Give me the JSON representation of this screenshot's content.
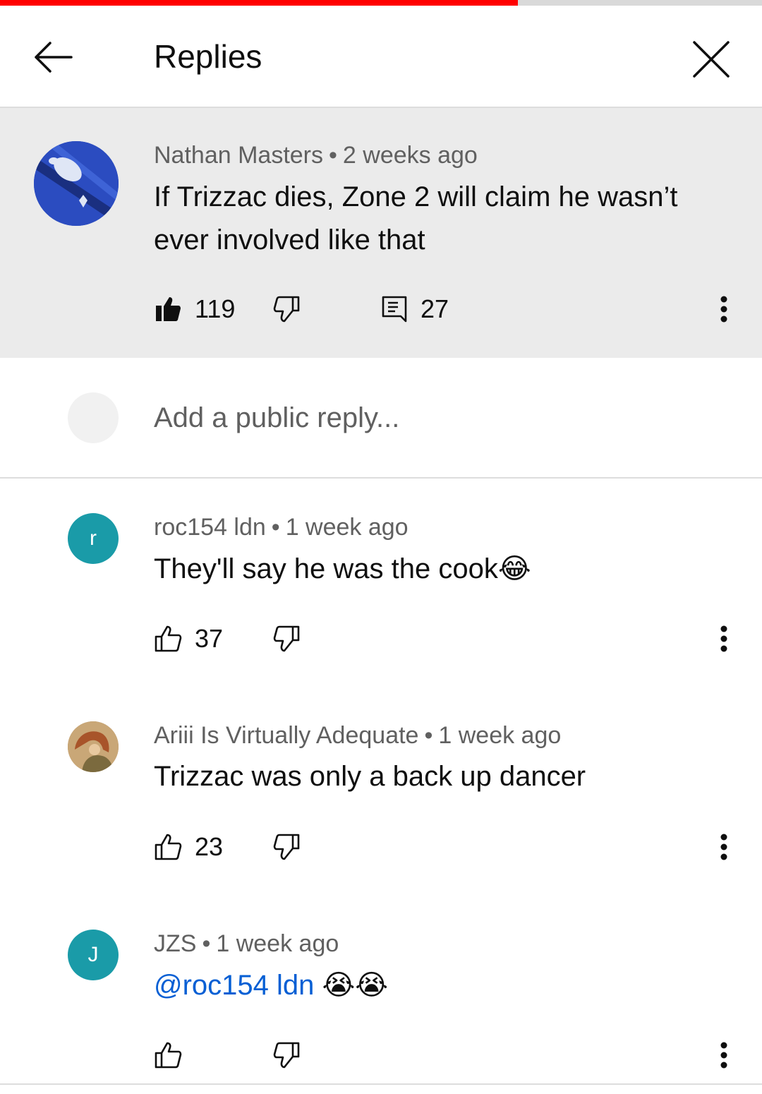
{
  "progress": {
    "fraction": 0.68,
    "color": "#ff0000"
  },
  "header": {
    "title": "Replies",
    "back_icon": "arrow-left-icon",
    "close_icon": "close-icon"
  },
  "parent_comment": {
    "author": "Nathan Masters",
    "time": "2 weeks ago",
    "text": "If Trizzac dies, Zone 2 will claim he wasn’t ever involved like that",
    "likes": "119",
    "replies": "27",
    "liked": true
  },
  "composer": {
    "placeholder": "Add a public reply..."
  },
  "replies": [
    {
      "avatar_letter": "r",
      "avatar_color": "#1a9ba8",
      "author": "roc154 ldn",
      "time": "1 week ago",
      "text": "They'll say he was the cook",
      "emoji": "😂",
      "likes": "37"
    },
    {
      "avatar_color": "#b08a5a",
      "author": "Ariii Is Virtually Adequate",
      "time": "1 week ago",
      "text": "Trizzac was only a back up dancer",
      "likes": "23"
    },
    {
      "avatar_letter": "J",
      "avatar_color": "#1a9ba8",
      "author": "JZS",
      "time": "1 week ago",
      "mention": "@roc154 ldn",
      "emoji": "😭😭",
      "likes": ""
    }
  ],
  "separator": "•"
}
